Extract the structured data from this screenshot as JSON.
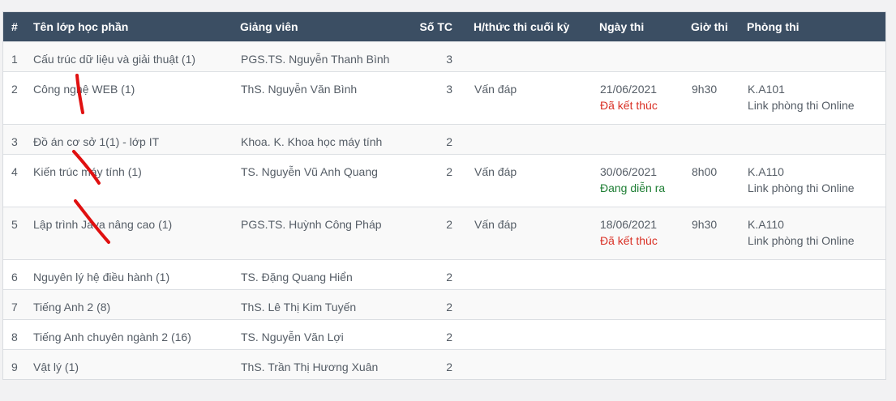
{
  "headers": {
    "idx": "#",
    "course": "Tên lớp học phần",
    "lecturer": "Giảng viên",
    "credits": "Số TC",
    "exam_form": "H/thức thi cuối kỳ",
    "exam_date": "Ngày thi",
    "exam_time": "Giờ thi",
    "room": "Phòng thi"
  },
  "rows": [
    {
      "idx": "1",
      "course": "Cấu trúc dữ liệu và giải thuật (1)",
      "lecturer": "PGS.TS. Nguyễn Thanh Bình",
      "credits": "3",
      "exam_form": "",
      "exam_date": "",
      "status": "",
      "status_type": "",
      "exam_time": "",
      "room": "",
      "room_link": ""
    },
    {
      "idx": "2",
      "course": "Công nghệ WEB (1)",
      "lecturer": "ThS. Nguyễn Văn Bình",
      "credits": "3",
      "exam_form": "Vấn đáp",
      "exam_date": "21/06/2021",
      "status": "Đã kết thúc",
      "status_type": "done",
      "exam_time": "9h30",
      "room": "K.A101",
      "room_link": "Link phòng thi Online"
    },
    {
      "idx": "3",
      "course": "Đồ án cơ sở 1(1) - lớp IT",
      "lecturer": "Khoa. K. Khoa học máy tính",
      "credits": "2",
      "exam_form": "",
      "exam_date": "",
      "status": "",
      "status_type": "",
      "exam_time": "",
      "room": "",
      "room_link": ""
    },
    {
      "idx": "4",
      "course": "Kiến trúc máy tính (1)",
      "lecturer": "TS. Nguyễn Vũ Anh Quang",
      "credits": "2",
      "exam_form": "Vấn đáp",
      "exam_date": "30/06/2021",
      "status": "Đang diễn ra",
      "status_type": "live",
      "exam_time": "8h00",
      "room": "K.A110",
      "room_link": "Link phòng thi Online"
    },
    {
      "idx": "5",
      "course": "Lập trình Java nâng cao (1)",
      "lecturer": "PGS.TS. Huỳnh Công Pháp",
      "credits": "2",
      "exam_form": "Vấn đáp",
      "exam_date": "18/06/2021",
      "status": "Đã kết thúc",
      "status_type": "done",
      "exam_time": "9h30",
      "room": "K.A110",
      "room_link": "Link phòng thi Online"
    },
    {
      "idx": "6",
      "course": "Nguyên lý hệ điều hành (1)",
      "lecturer": "TS. Đặng Quang Hiển",
      "credits": "2",
      "exam_form": "",
      "exam_date": "",
      "status": "",
      "status_type": "",
      "exam_time": "",
      "room": "",
      "room_link": ""
    },
    {
      "idx": "7",
      "course": "Tiếng Anh 2 (8)",
      "lecturer": "ThS. Lê Thị Kim Tuyến",
      "credits": "2",
      "exam_form": "",
      "exam_date": "",
      "status": "",
      "status_type": "",
      "exam_time": "",
      "room": "",
      "room_link": ""
    },
    {
      "idx": "8",
      "course": "Tiếng Anh chuyên ngành 2 (16)",
      "lecturer": "TS. Nguyễn Văn Lợi",
      "credits": "2",
      "exam_form": "",
      "exam_date": "",
      "status": "",
      "status_type": "",
      "exam_time": "",
      "room": "",
      "room_link": ""
    },
    {
      "idx": "9",
      "course": "Vật lý (1)",
      "lecturer": "ThS. Trần Thị Hương Xuân",
      "credits": "2",
      "exam_form": "",
      "exam_date": "",
      "status": "",
      "status_type": "",
      "exam_time": "",
      "room": "",
      "room_link": ""
    }
  ],
  "colors": {
    "header_bg": "#3b4e63",
    "status_done": "#d93025",
    "status_live": "#1e7e34",
    "annotation": "#e01010"
  }
}
